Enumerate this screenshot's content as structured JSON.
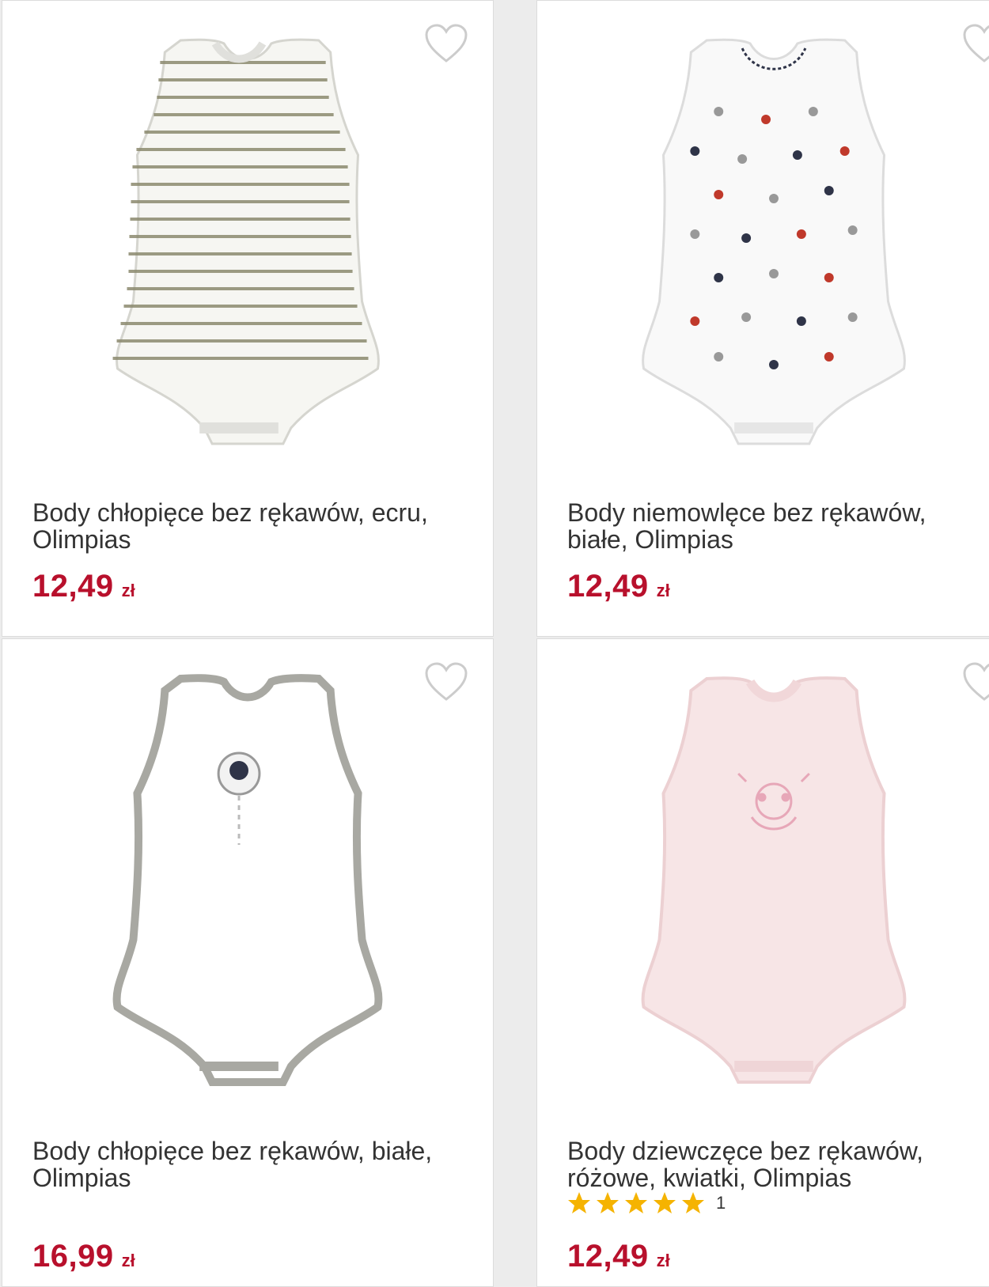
{
  "products": [
    {
      "title": "Body chłopięce bez rękawów, ecru, Olimpias",
      "price": "12,49",
      "currency": "zł",
      "image": "striped-sleeveless-bodysuit"
    },
    {
      "title": "Body niemowlęce bez rękawów, białe, Olimpias",
      "price": "12,49",
      "currency": "zł",
      "image": "white-polka-dot-bodysuit"
    },
    {
      "title": "Body chłopięce bez rękawów, białe, Olimpias",
      "price": "16,99",
      "currency": "zł",
      "image": "white-grey-trim-bodysuit"
    },
    {
      "title": "Body dziewczęce bez rękawów, różowe, kwiatki, Olimpias",
      "price": "12,49",
      "currency": "zł",
      "image": "pink-bodysuit",
      "rating": 5,
      "rating_count": "1"
    }
  ],
  "colors": {
    "price": "#b8102c",
    "star": "#f5b301",
    "heart": "#cccccc"
  },
  "icons": {
    "favorite": "heart-outline-icon",
    "star": "star-icon"
  }
}
